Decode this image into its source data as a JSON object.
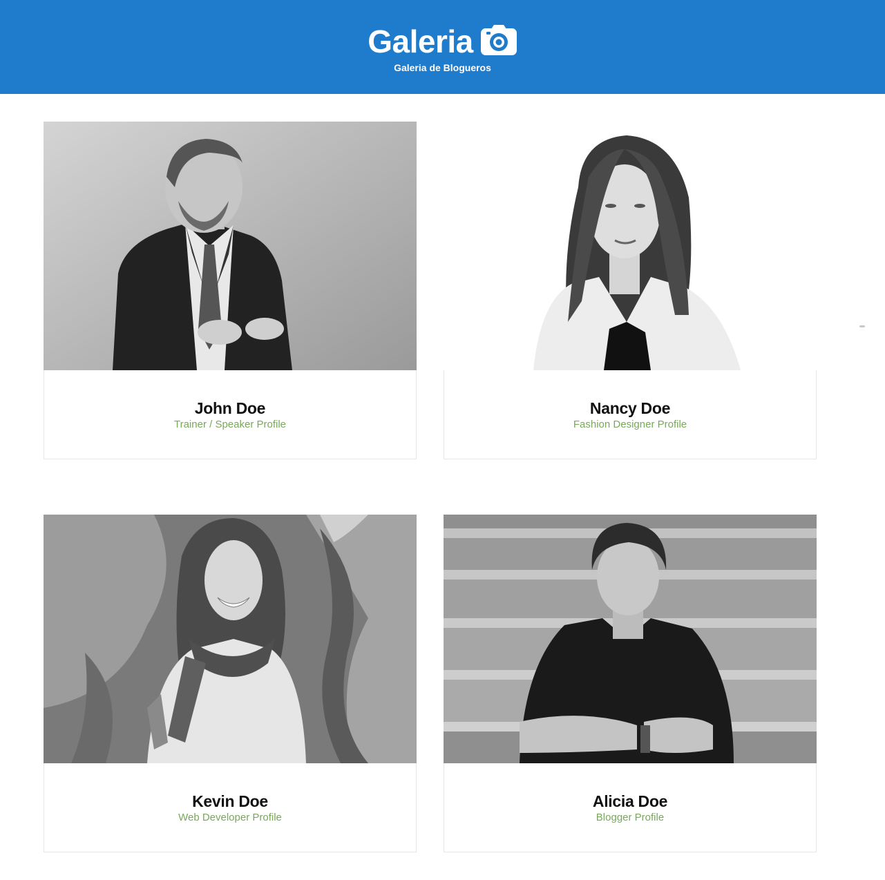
{
  "header": {
    "title": "Galeria",
    "subtitle": "Galeria de Blogueros",
    "icon": "camera-icon",
    "background": "#1f7bcc"
  },
  "profiles": [
    {
      "name": "John Doe",
      "role": "Trainer / Speaker Profile"
    },
    {
      "name": "Nancy Doe",
      "role": "Fashion Designer Profile"
    },
    {
      "name": "Kevin Doe",
      "role": "Web Developer Profile"
    },
    {
      "name": "Alicia Doe",
      "role": "Blogger Profile"
    }
  ],
  "colors": {
    "role_text": "#78a85a",
    "name_text": "#111111",
    "card_border": "#e6e6e6"
  }
}
